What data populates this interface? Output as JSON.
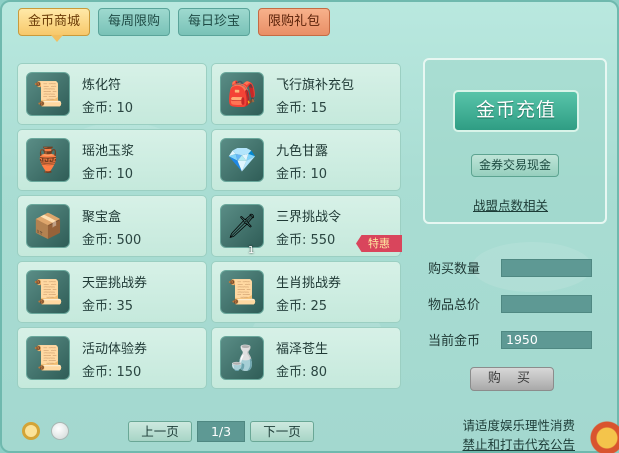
{
  "tabs": [
    {
      "label": "金币商城",
      "active": true
    },
    {
      "label": "每周限购",
      "active": false
    },
    {
      "label": "每日珍宝",
      "active": false
    },
    {
      "label": "限购礼包",
      "active": false
    }
  ],
  "items": [
    {
      "name": "炼化符",
      "price": "金币: 10",
      "icon": "talisman-icon",
      "glyph": "📜"
    },
    {
      "name": "飞行旗补充包",
      "price": "金币: 15",
      "icon": "flag-bag-icon",
      "glyph": "🎒"
    },
    {
      "name": "瑶池玉浆",
      "price": "金币: 10",
      "icon": "jade-pot-icon",
      "glyph": "🏺"
    },
    {
      "name": "九色甘露",
      "price": "金币: 10",
      "icon": "dew-gem-icon",
      "glyph": "💎"
    },
    {
      "name": "聚宝盒",
      "price": "金币: 500",
      "icon": "treasure-box-icon",
      "glyph": "📦"
    },
    {
      "name": "三界挑战令",
      "price": "金币: 550",
      "icon": "challenge-token-icon",
      "glyph": "🗡",
      "qty": "1",
      "badge": "特惠"
    },
    {
      "name": "天罡挑战券",
      "price": "金币: 35",
      "icon": "scroll-icon",
      "glyph": "📜"
    },
    {
      "name": "生肖挑战券",
      "price": "金币: 25",
      "icon": "scroll-icon",
      "glyph": "📜"
    },
    {
      "name": "活动体验券",
      "price": "金币: 150",
      "icon": "scroll-icon",
      "glyph": "📜"
    },
    {
      "name": "福泽苍生",
      "price": "金币: 80",
      "icon": "blessing-bottle-icon",
      "glyph": "🍶"
    }
  ],
  "right": {
    "recharge_label": "金币充值",
    "trade_label": "金券交易现金",
    "alliance_label": "战盟点数相关"
  },
  "purchase": {
    "qty_label": "购买数量",
    "qty_value": "",
    "total_label": "物品总价",
    "total_value": "",
    "gold_label": "当前金币",
    "gold_value": "1950",
    "buy_label": "购 买"
  },
  "pager": {
    "prev_label": "上一页",
    "indicator": "1/3",
    "next_label": "下一页"
  },
  "notice": {
    "line1": "请适度娱乐理性消费",
    "line2": "禁止和打击代充公告"
  }
}
